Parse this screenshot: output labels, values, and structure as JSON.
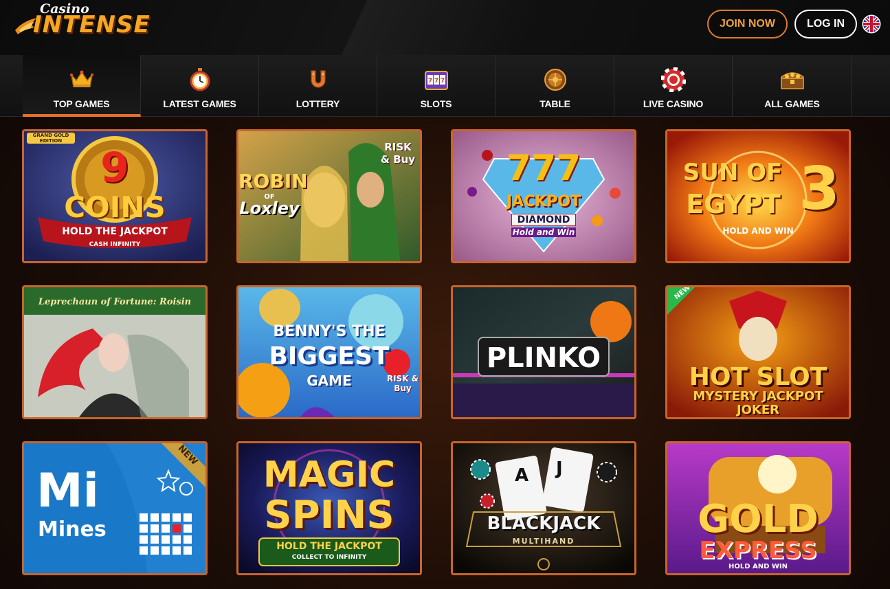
{
  "brand": {
    "small": "Casino",
    "big": "INTENSE"
  },
  "auth": {
    "join_label": "JOIN NOW",
    "login_label": "LOG IN"
  },
  "nav": {
    "items": [
      {
        "label": "TOP GAMES",
        "icon": "crown-icon",
        "active": true
      },
      {
        "label": "LATEST GAMES",
        "icon": "stopwatch-icon"
      },
      {
        "label": "LOTTERY",
        "icon": "horseshoe-icon"
      },
      {
        "label": "SLOTS",
        "icon": "slot-machine-icon"
      },
      {
        "label": "TABLE",
        "icon": "roulette-icon"
      },
      {
        "label": "LIVE CASINO",
        "icon": "poker-chip-icon"
      },
      {
        "label": "ALL GAMES",
        "icon": "treasure-chest-icon"
      }
    ]
  },
  "games": [
    {
      "line1": "9",
      "line2": "COINS",
      "line3": "HOLD THE JACKPOT",
      "line4": "CASH INFINITY",
      "badge": "GRAND GOLD EDITION"
    },
    {
      "line1": "ROBIN",
      "line2": "OF",
      "line3": "Loxley",
      "badge": "RISK & Buy"
    },
    {
      "line1": "777",
      "line2": "JACKPOT",
      "line3": "DIAMOND",
      "line4": "Hold and Win"
    },
    {
      "line1": "SUN OF",
      "line2": "EGYPT",
      "line3": "3",
      "line4": "HOLD AND WIN"
    },
    {
      "line1": "Leprechaun of Fortune: Roisin"
    },
    {
      "line1": "BENNY'S THE",
      "line2": "BIGGEST",
      "line3": "GAME",
      "badge": "RISK & Buy"
    },
    {
      "line1": "PLINKO"
    },
    {
      "line1": "HOT SLOT",
      "line2": "MYSTERY JACKPOT",
      "line3": "JOKER",
      "badge": "NEW"
    },
    {
      "line1": "Mi",
      "line2": "Mines",
      "badge": "NEW"
    },
    {
      "line1": "MAGIC",
      "line2": "SPINS",
      "line3": "HOLD THE JACKPOT",
      "line4": "COLLECT TO INFINITY"
    },
    {
      "line1": "BLACKJACK",
      "line2": "MULTIHAND"
    },
    {
      "line1": "GOLD",
      "line2": "EXPRESS",
      "line3": "HOLD AND WIN"
    }
  ],
  "colors": {
    "accent": "#e8702a",
    "tile_border": "#c9652a",
    "join_text": "#f0a040"
  }
}
